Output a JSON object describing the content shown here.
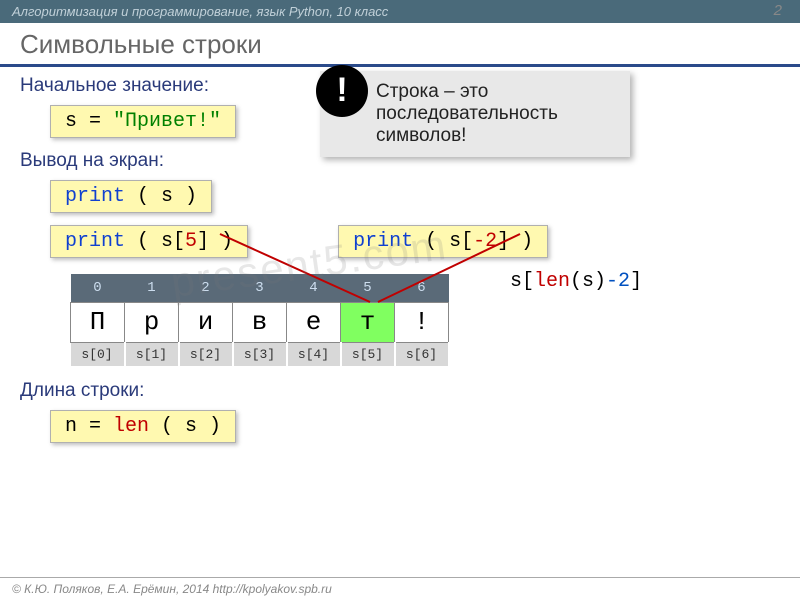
{
  "header": {
    "breadcrumb": "Алгоритмизация и программирование, язык Python, 10 класс",
    "page_number": "2"
  },
  "title": "Символьные строки",
  "sections": {
    "initial": "Начальное значение:",
    "output": "Вывод на экран:",
    "length": "Длина строки:"
  },
  "code": {
    "assign_lhs": "s = ",
    "assign_str": "\"Привет!\"",
    "print1_a": "print",
    "print1_b": " ( s )",
    "print2_a": "print",
    "print2_b": " ( s[",
    "print2_idx": "5",
    "print2_c": "] )",
    "print3_a": "print",
    "print3_b": " ( s[",
    "print3_idx": "-2",
    "print3_c": "] )",
    "len_a": "n = ",
    "len_b": "len",
    "len_c": " ( s )"
  },
  "callout": {
    "badge": "!",
    "text": "Строка – это последовательность символов!"
  },
  "table": {
    "indices": [
      "0",
      "1",
      "2",
      "3",
      "4",
      "5",
      "6"
    ],
    "chars": [
      "П",
      "р",
      "и",
      "в",
      "е",
      "т",
      "!"
    ],
    "refs": [
      "s[0]",
      "s[1]",
      "s[2]",
      "s[3]",
      "s[4]",
      "s[5]",
      "s[6]"
    ],
    "highlight_col": 5
  },
  "side_expression": {
    "pre": "s[",
    "len": "len",
    "mid": "(s)",
    "minus": "-2",
    "post": "]"
  },
  "footer": "© К.Ю. Поляков, Е.А. Ерёмин, 2014    http://kpolyakov.spb.ru",
  "watermark": "present5.com"
}
